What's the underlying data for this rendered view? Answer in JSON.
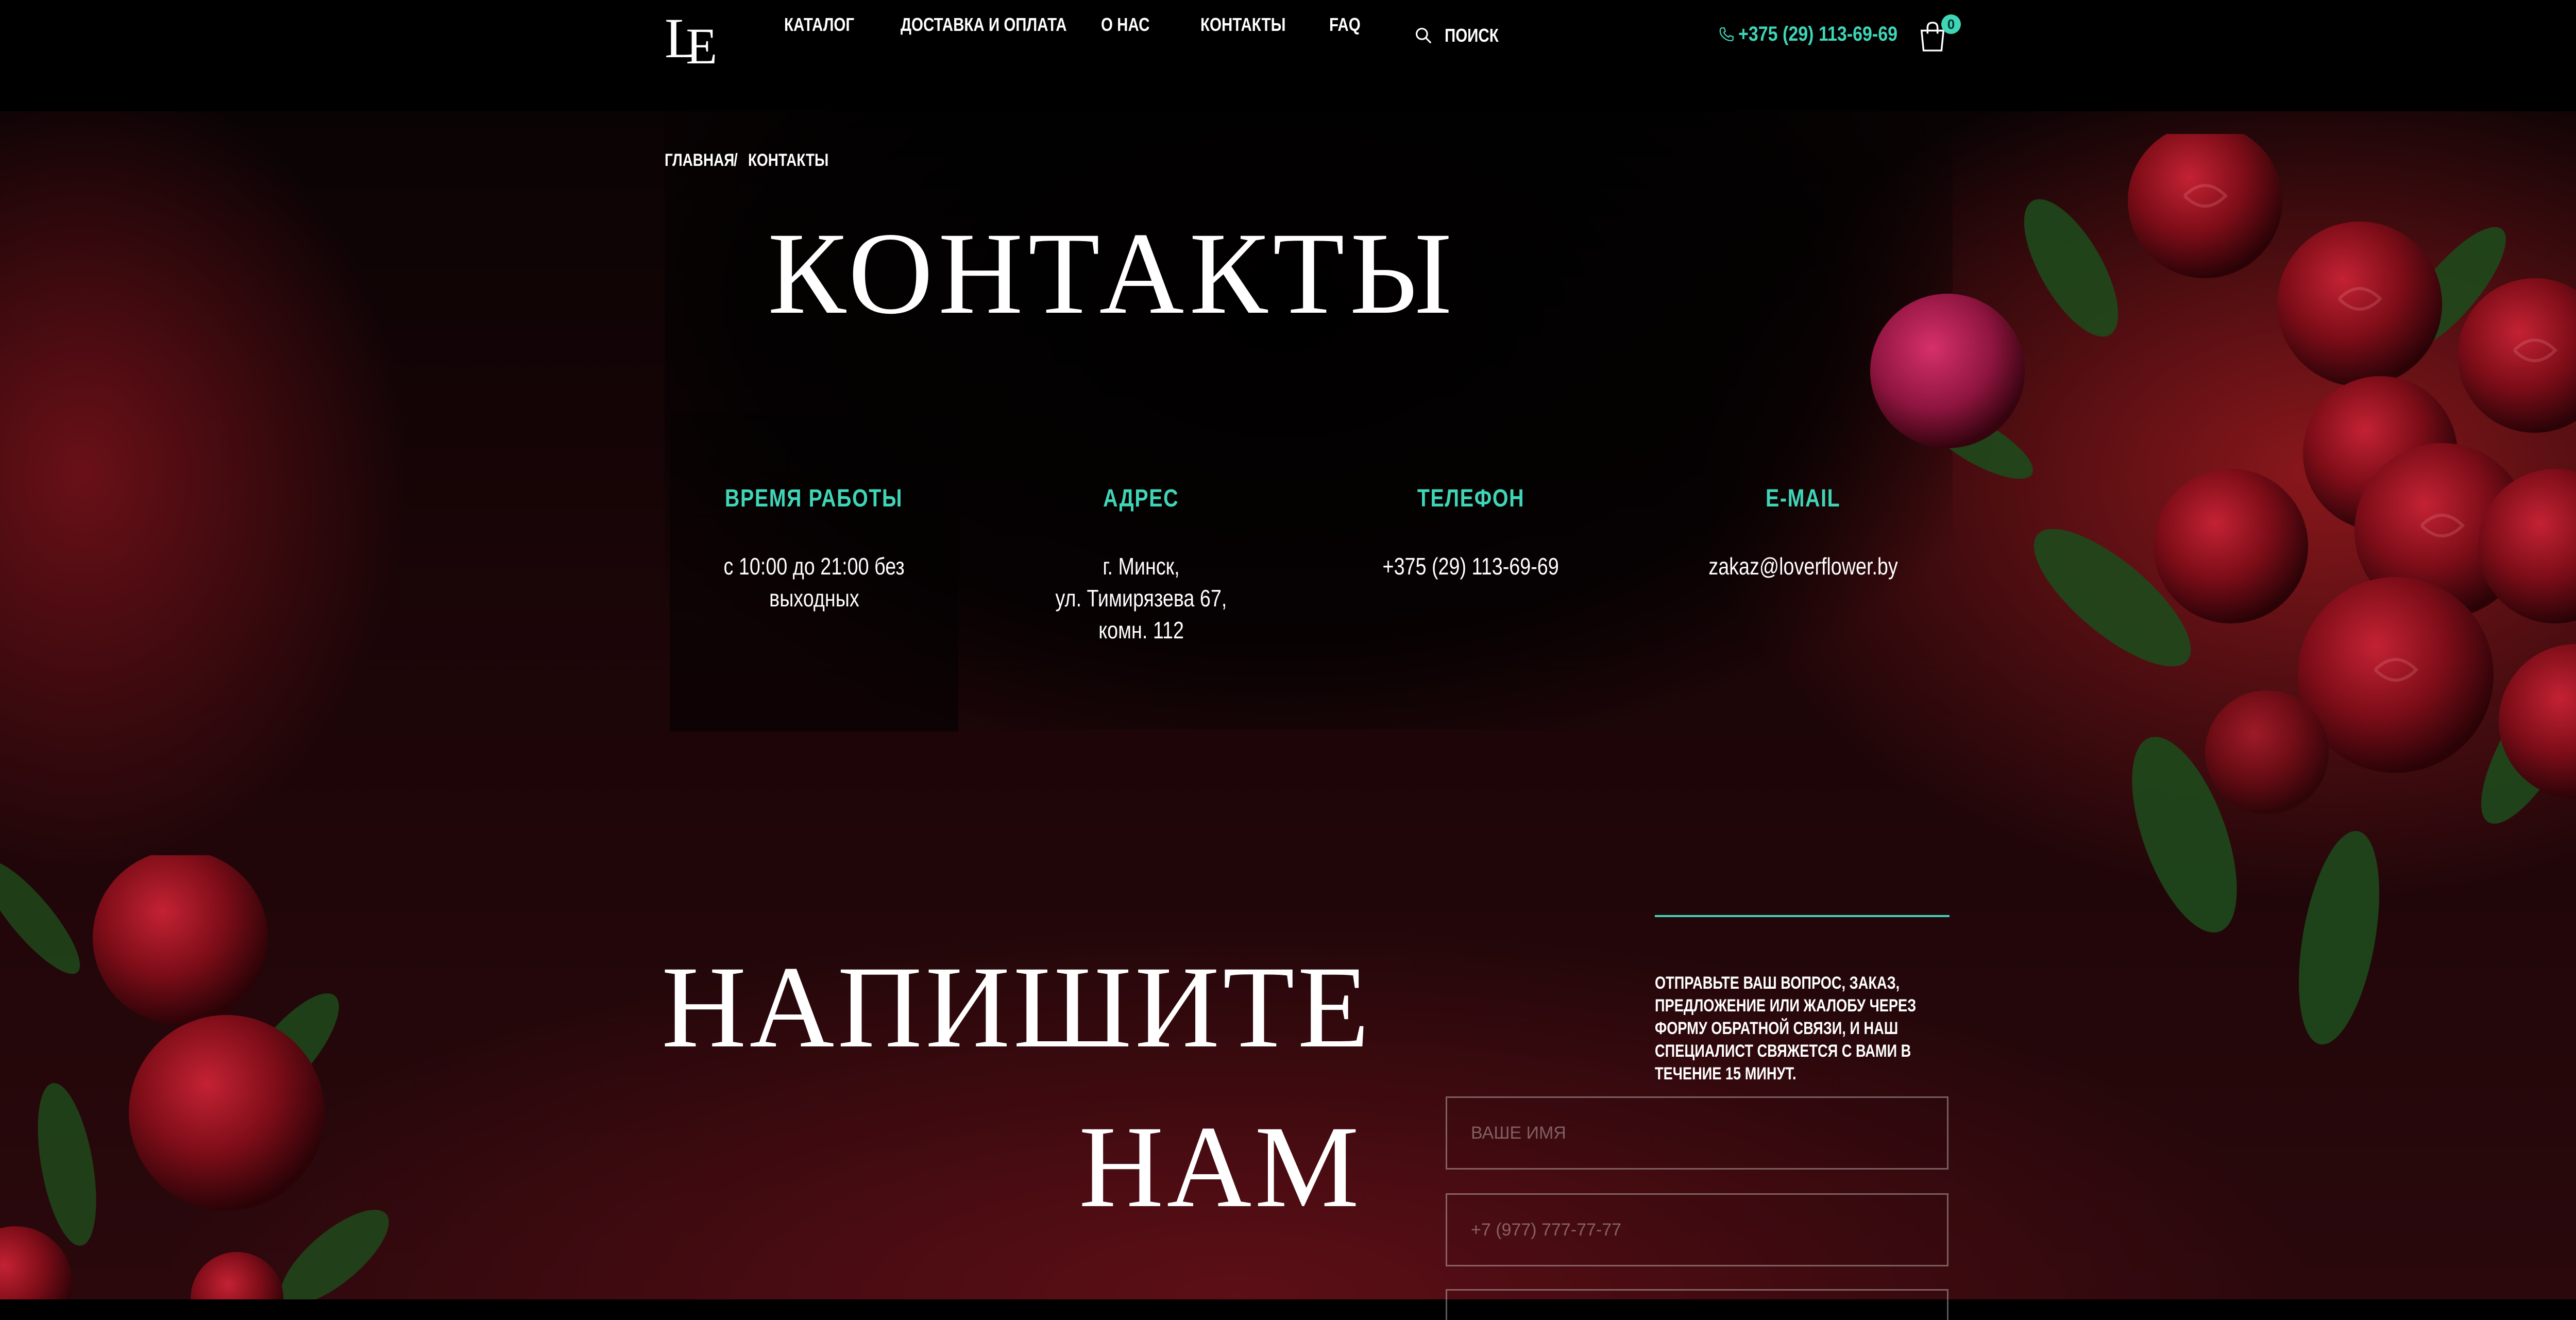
{
  "header": {
    "logo": "LE",
    "nav": [
      {
        "label": "КАТАЛОГ"
      },
      {
        "label": "ДОСТАВКА И ОПЛАТА"
      },
      {
        "label": "О НАС"
      },
      {
        "label": "КОНТАКТЫ"
      },
      {
        "label": "FAQ"
      }
    ],
    "search_label": "ПОИСК",
    "phone": "+375 (29) 113-69-69",
    "cart_count": "0"
  },
  "breadcrumb": {
    "home": "ГЛАВНАЯ",
    "separator": "/",
    "current": "КОНТАКТЫ"
  },
  "page_title": "КОНТАКТЫ",
  "info": {
    "hours": {
      "heading": "ВРЕМЯ РАБОТЫ",
      "line1": "с 10:00 до 21:00 без",
      "line2": "выходных"
    },
    "address": {
      "heading": "АДРЕС",
      "line1": "г. Минск,",
      "line2": "ул. Тимирязева 67,",
      "line3": "комн. 112"
    },
    "phone": {
      "heading": "ТЕЛЕФОН",
      "value": "+375 (29) 113-69-69"
    },
    "email": {
      "heading": "E-MAIL",
      "value": "zakaz@loverflower.by"
    }
  },
  "write_us": {
    "title_line1": "НАПИШИТЕ",
    "title_line2": "НАМ",
    "description": "ОТПРАВЬТЕ ВАШ ВОПРОС, ЗАКАЗ, ПРЕДЛОЖЕНИЕ ИЛИ ЖАЛОБУ ЧЕРЕЗ ФОРМУ ОБРАТНОЙ СВЯЗИ, И НАШ СПЕЦИАЛИСТ СВЯЖЕТСЯ С ВАМИ В ТЕЧЕНИЕ 15 МИНУТ.",
    "name_placeholder": "ВАШЕ ИМЯ",
    "phone_placeholder": "+7 (977) 777-77-77",
    "name_value": "",
    "phone_value": ""
  },
  "colors": {
    "accent": "#3fd6b8",
    "background": "#000000",
    "hero_red": "#7a121a"
  },
  "icons": [
    "search-icon",
    "phone-icon",
    "cart-icon",
    "logo"
  ]
}
